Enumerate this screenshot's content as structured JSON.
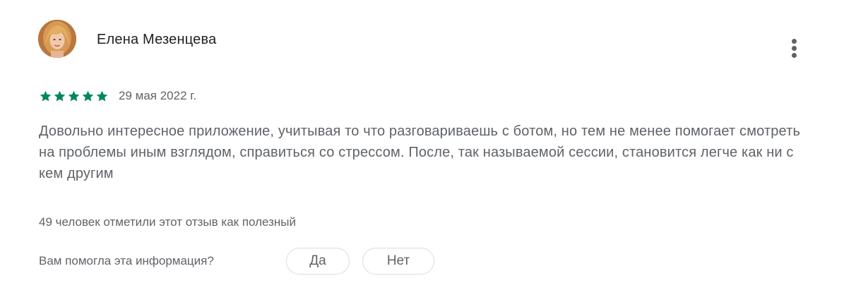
{
  "review": {
    "author": {
      "name": "Елена Мезенцева",
      "avatar": "profile-photo"
    },
    "menu_icon": "more-vertical-icon",
    "rating": 5,
    "rating_max": 5,
    "star_color": "#01875f",
    "date": "29 мая 2022 г.",
    "text": "Довольно интересное приложение, учитывая то что разговариваешь с ботом, но тем не менее помогает смотреть на проблемы иным взглядом, справиться со стрессом. После, так называемой сессии, становится легче как ни с кем другим",
    "helpful_count_text": "49 человек отметили этот отзыв как полезный",
    "feedback": {
      "question": "Вам помогла эта информация?",
      "yes_label": "Да",
      "no_label": "Нет"
    }
  }
}
